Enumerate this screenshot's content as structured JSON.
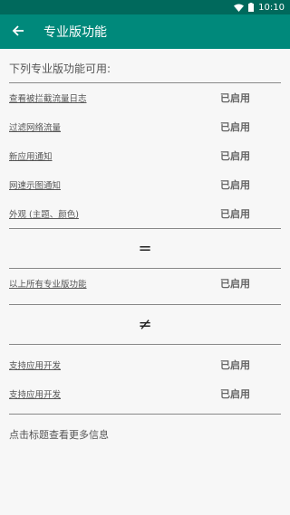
{
  "status_bar": {
    "time": "10:10"
  },
  "toolbar": {
    "title": "专业版功能"
  },
  "header": "下列专业版功能可用:",
  "features": [
    {
      "label": "查看被拦截流量日志",
      "status": "已启用"
    },
    {
      "label": "过滤网络流量",
      "status": "已启用"
    },
    {
      "label": "新应用通知",
      "status": "已启用"
    },
    {
      "label": "网速示图通知",
      "status": "已启用"
    },
    {
      "label": "外观 (主题、颜色)",
      "status": "已启用"
    }
  ],
  "equals_symbol": "=",
  "all_features": {
    "label": "以上所有专业版功能",
    "status": "已启用"
  },
  "not_equal_symbol": "≠",
  "support": [
    {
      "label": "支持应用开发",
      "status": "已启用"
    },
    {
      "label": "支持应用开发",
      "status": "已启用"
    }
  ],
  "footer": "点击标题查看更多信息"
}
